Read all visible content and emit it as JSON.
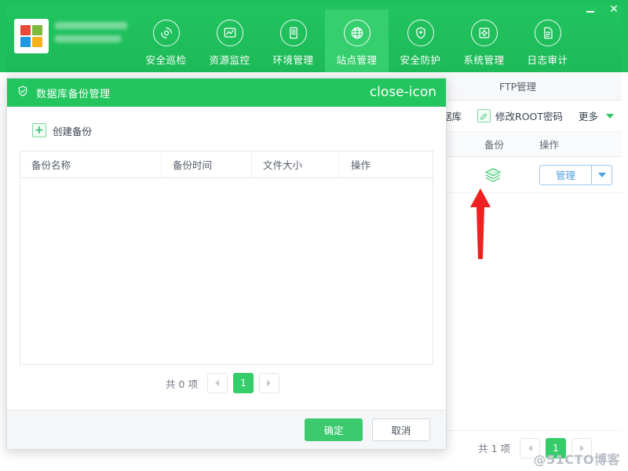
{
  "window": {
    "minimize_label": "—",
    "close_label": "✕"
  },
  "topbar": {
    "logo_icon": "windows-logo-icon",
    "logo_colors": [
      "#e8493a",
      "#7cb93c",
      "#1f9ae0",
      "#f5b21a"
    ],
    "brand_text_redacted": true,
    "accent_green": "#1ec05c",
    "active_green": "#35cf6e",
    "nav": [
      {
        "label": "安全巡检",
        "icon": "security-inspection-icon",
        "active": false
      },
      {
        "label": "资源监控",
        "icon": "resource-monitor-icon",
        "active": false
      },
      {
        "label": "环境管理",
        "icon": "environment-manage-icon",
        "active": false
      },
      {
        "label": "站点管理",
        "icon": "site-manage-globe-icon",
        "active": true
      },
      {
        "label": "安全防护",
        "icon": "security-shield-icon",
        "active": false
      },
      {
        "label": "系统管理",
        "icon": "system-settings-icon",
        "active": false
      },
      {
        "label": "日志审计",
        "icon": "log-audit-icon",
        "active": false
      }
    ]
  },
  "background_page": {
    "tab_label": "FTP管理",
    "toolbar": {
      "database_partial_label": "据库",
      "root_password_label": "修改ROOT密码",
      "root_password_icon": "edit-pencil-icon",
      "more_label": "更多",
      "more_icon": "chevron-down-icon"
    },
    "table": {
      "columns": [
        "备份",
        "操作"
      ],
      "rows": [
        {
          "backup_icon": "layers-stack-icon",
          "action_label": "管理",
          "action_caret_icon": "chevron-down-icon"
        }
      ]
    },
    "pagination": {
      "total_label": "共 1 项",
      "prev_icon": "chevron-left-icon",
      "current_page": "1",
      "next_icon": "chevron-right-icon"
    },
    "watermark": "@51CTO博客"
  },
  "annotation": {
    "arrow_icon": "red-up-arrow-icon",
    "arrow_color": "#ee2020"
  },
  "modal": {
    "title": "数据库备份管理",
    "title_icon": "shield-check-icon",
    "close_icon": "close-icon",
    "header_color": "#22c55e",
    "create_backup_label": "创建备份",
    "create_backup_icon": "plus-icon",
    "table": {
      "columns": [
        "备份名称",
        "备份时间",
        "文件大小",
        "操作"
      ],
      "rows": []
    },
    "pagination": {
      "total_label": "共 0 项",
      "prev_icon": "chevron-left-icon",
      "current_page": "1",
      "next_icon": "chevron-right-icon"
    },
    "footer": {
      "confirm_label": "确定",
      "cancel_label": "取消"
    }
  }
}
